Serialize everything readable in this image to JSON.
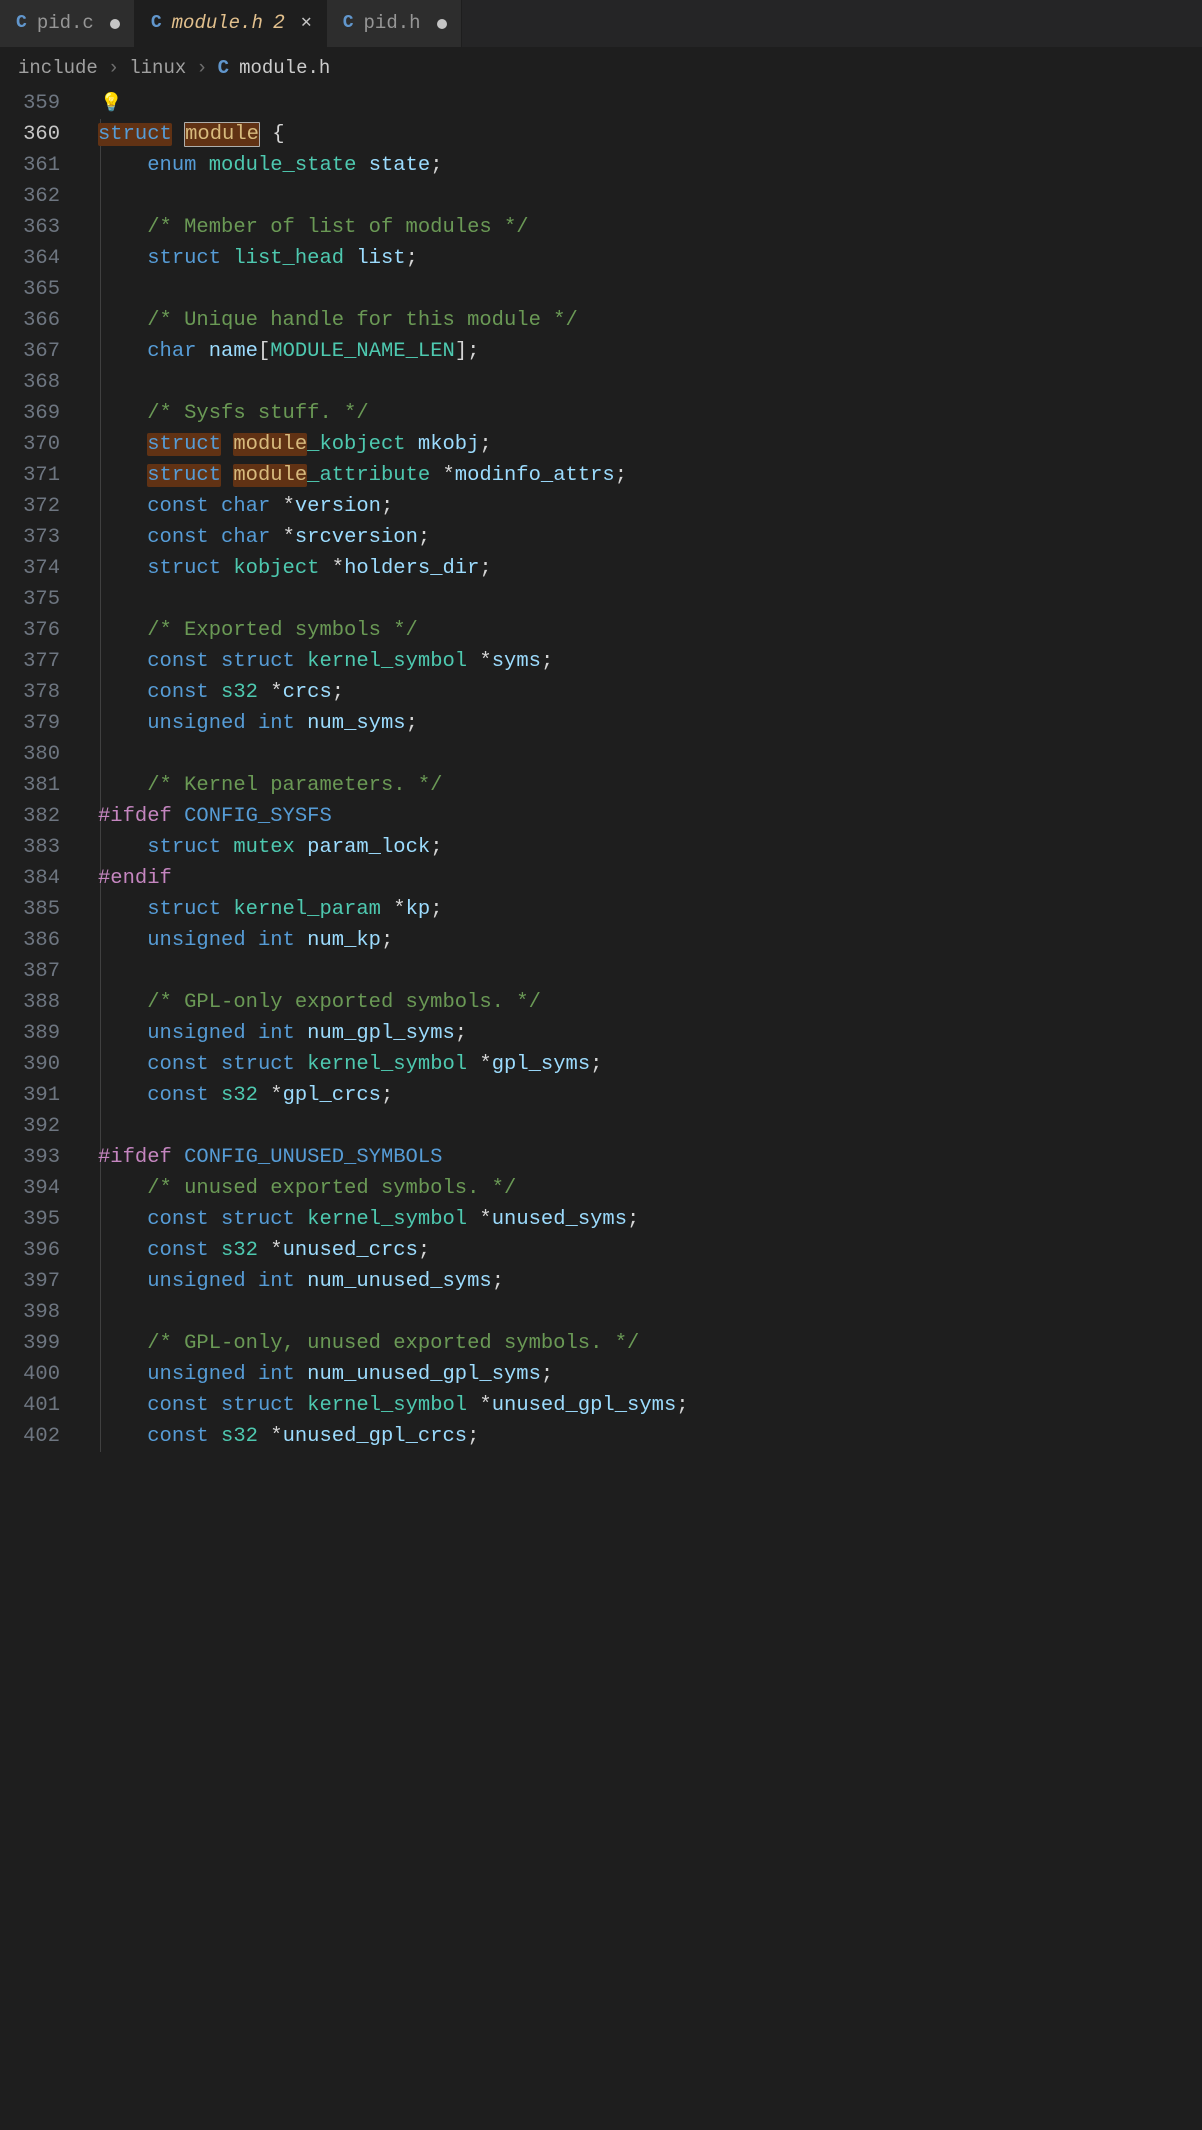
{
  "tabs": [
    {
      "lang": "C",
      "label": "pid.c",
      "dirty": true,
      "active": false
    },
    {
      "lang": "C",
      "label": "module.h",
      "dirty": false,
      "active": true,
      "modifiedCount": "2"
    },
    {
      "lang": "C",
      "label": "pid.h",
      "dirty": true,
      "active": false
    }
  ],
  "breadcrumb": {
    "parts": [
      "include",
      "linux"
    ],
    "fileLang": "C",
    "fileName": "module.h",
    "sep": "›"
  },
  "gutter": {
    "start": 359,
    "end": 402,
    "current": 360
  },
  "bulb": "💡",
  "code": {
    "l359": "",
    "l360": {
      "kw": "struct",
      "sel": "module",
      "brace": "{"
    },
    "l361": {
      "t": [
        "enum",
        " ",
        "module_state",
        " ",
        "state",
        ";"
      ]
    },
    "l362": "",
    "l363": "/* Member of list of modules */",
    "l364": {
      "t": [
        "struct",
        " ",
        "list_head",
        " ",
        "list",
        ";"
      ]
    },
    "l365": "",
    "l366": "/* Unique handle for this module */",
    "l367": {
      "t": [
        "char",
        " ",
        "name",
        "[",
        "MODULE_NAME_LEN",
        "]",
        ";"
      ]
    },
    "l368": "",
    "l369": "/* Sysfs stuff. */",
    "l370": {
      "t": [
        "struct",
        " ",
        "module",
        "_kobject",
        " ",
        "mkobj",
        ";"
      ]
    },
    "l371": {
      "t": [
        "struct",
        " ",
        "module",
        "_attribute",
        " *",
        "modinfo_attrs",
        ";"
      ]
    },
    "l372": {
      "t": [
        "const",
        " ",
        "char",
        " *",
        "version",
        ";"
      ]
    },
    "l373": {
      "t": [
        "const",
        " ",
        "char",
        " *",
        "srcversion",
        ";"
      ]
    },
    "l374": {
      "t": [
        "struct",
        " ",
        "kobject",
        " *",
        "holders_dir",
        ";"
      ]
    },
    "l375": "",
    "l376": "/* Exported symbols */",
    "l377": {
      "t": [
        "const",
        " ",
        "struct",
        " ",
        "kernel_symbol",
        " *",
        "syms",
        ";"
      ]
    },
    "l378": {
      "t": [
        "const",
        " ",
        "s32",
        " *",
        "crcs",
        ";"
      ]
    },
    "l379": {
      "t": [
        "unsigned",
        " ",
        "int",
        " ",
        "num_syms",
        ";"
      ]
    },
    "l380": "",
    "l381": "/* Kernel parameters. */",
    "l382": {
      "pp": "#ifdef",
      "mac": "CONFIG_SYSFS"
    },
    "l383": {
      "t": [
        "struct",
        " ",
        "mutex",
        " ",
        "param_lock",
        ";"
      ]
    },
    "l384": {
      "pp": "#endif"
    },
    "l385": {
      "t": [
        "struct",
        " ",
        "kernel_param",
        " *",
        "kp",
        ";"
      ]
    },
    "l386": {
      "t": [
        "unsigned",
        " ",
        "int",
        " ",
        "num_kp",
        ";"
      ]
    },
    "l387": "",
    "l388": "/* GPL-only exported symbols. */",
    "l389": {
      "t": [
        "unsigned",
        " ",
        "int",
        " ",
        "num_gpl_syms",
        ";"
      ]
    },
    "l390": {
      "t": [
        "const",
        " ",
        "struct",
        " ",
        "kernel_symbol",
        " *",
        "gpl_syms",
        ";"
      ]
    },
    "l391": {
      "t": [
        "const",
        " ",
        "s32",
        " *",
        "gpl_crcs",
        ";"
      ]
    },
    "l392": "",
    "l393": {
      "pp": "#ifdef",
      "mac": "CONFIG_UNUSED_SYMBOLS"
    },
    "l394": "/* unused exported symbols. */",
    "l395": {
      "t": [
        "const",
        " ",
        "struct",
        " ",
        "kernel_symbol",
        " *",
        "unused_syms",
        ";"
      ]
    },
    "l396": {
      "t": [
        "const",
        " ",
        "s32",
        " *",
        "unused_crcs",
        ";"
      ]
    },
    "l397": {
      "t": [
        "unsigned",
        " ",
        "int",
        " ",
        "num_unused_syms",
        ";"
      ]
    },
    "l398": "",
    "l399": "/* GPL-only, unused exported symbols. */",
    "l400": {
      "t": [
        "unsigned",
        " ",
        "int",
        " ",
        "num_unused_gpl_syms",
        ";"
      ]
    },
    "l401": {
      "t": [
        "const",
        " ",
        "struct",
        " ",
        "kernel_symbol",
        " *",
        "unused_gpl_syms",
        ";"
      ]
    },
    "l402": {
      "t": [
        "const",
        " ",
        "s32",
        " *",
        "unused_gpl_crcs",
        ";"
      ]
    }
  }
}
